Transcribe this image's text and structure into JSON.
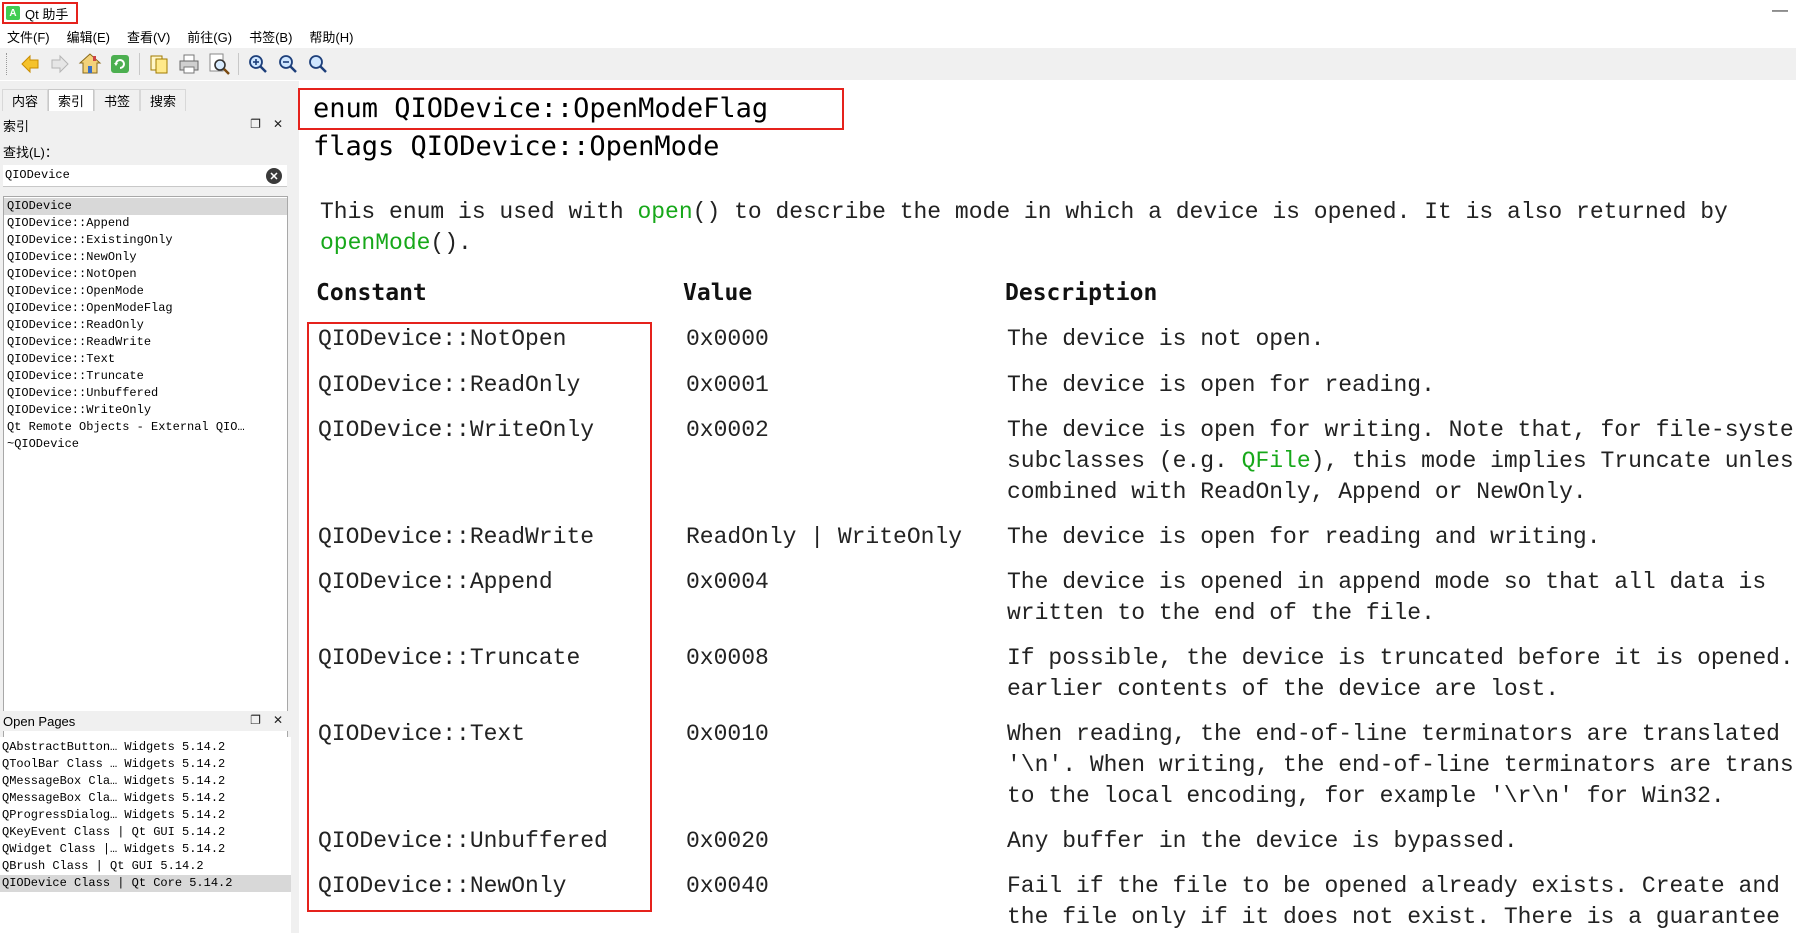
{
  "window": {
    "title": "Qt 助手",
    "minimize_glyph": "—"
  },
  "menu": [
    "文件(F)",
    "编辑(E)",
    "查看(V)",
    "前往(G)",
    "书签(B)",
    "帮助(H)"
  ],
  "toolbar": {
    "buttons": [
      "back-icon",
      "forward-icon",
      "home-icon",
      "sync-icon",
      "copy-icon",
      "print-icon",
      "find-icon",
      "zoom-in-icon",
      "zoom-out-icon",
      "zoom-reset-icon"
    ]
  },
  "sidebar": {
    "tabs": [
      "内容",
      "索引",
      "书签",
      "搜索"
    ],
    "active_tab": "索引",
    "index_panel_title": "索引",
    "find_label": "查找(L)：",
    "search_value": "QIODevice",
    "index_items": [
      "QIODevice",
      "QIODevice::Append",
      "QIODevice::ExistingOnly",
      "QIODevice::NewOnly",
      "QIODevice::NotOpen",
      "QIODevice::OpenMode",
      "QIODevice::OpenModeFlag",
      "QIODevice::ReadOnly",
      "QIODevice::ReadWrite",
      "QIODevice::Text",
      "QIODevice::Truncate",
      "QIODevice::Unbuffered",
      "QIODevice::WriteOnly",
      "Qt Remote Objects - External QIO…",
      "~QIODevice"
    ],
    "open_pages_title": "Open Pages",
    "open_pages": [
      "QAbstractButton… Widgets 5.14.2",
      "QToolBar Class … Widgets 5.14.2",
      "QMessageBox Cla… Widgets 5.14.2",
      "QMessageBox Cla… Widgets 5.14.2",
      "QProgressDialog… Widgets 5.14.2",
      "QKeyEvent Class | Qt GUI 5.14.2",
      "QWidget Class |… Widgets 5.14.2",
      "QBrush Class | Qt GUI 5.14.2",
      "QIODevice Class | Qt Core 5.14.2"
    ]
  },
  "doc": {
    "enum_title": "enum QIODevice::OpenModeFlag",
    "flags_title": "flags QIODevice::OpenMode",
    "intro": {
      "part1": "This enum is used with ",
      "link1": "open",
      "part2": "() to describe the mode in which a device is opened. It is also returned by",
      "link2": "openMode",
      "part3": "()."
    },
    "table_headers": [
      "Constant",
      "Value",
      "Description"
    ],
    "rows": [
      {
        "constant": "QIODevice::NotOpen",
        "value": "0x0000",
        "desc": [
          "The device is not open."
        ]
      },
      {
        "constant": "QIODevice::ReadOnly",
        "value": "0x0001",
        "desc": [
          "The device is open for reading."
        ]
      },
      {
        "constant": "QIODevice::WriteOnly",
        "value": "0x0002",
        "desc": [
          "The device is open for writing. Note that, for file-syste",
          "subclasses (e.g. ",
          "QFile",
          "), this mode implies Truncate unles",
          "combined with ReadOnly, Append or NewOnly."
        ]
      },
      {
        "constant": "QIODevice::ReadWrite",
        "value": "ReadOnly | WriteOnly",
        "desc": [
          "The device is open for reading and writing."
        ]
      },
      {
        "constant": "QIODevice::Append",
        "value": "0x0004",
        "desc": [
          "The device is opened in append mode so that all data is",
          "written to the end of the file."
        ]
      },
      {
        "constant": "QIODevice::Truncate",
        "value": "0x0008",
        "desc": [
          "If possible, the device is truncated before it is opened.",
          "earlier contents of the device are lost."
        ]
      },
      {
        "constant": "QIODevice::Text",
        "value": "0x0010",
        "desc": [
          "When reading, the end-of-line terminators are translated",
          "'\\n'. When writing, the end-of-line terminators are trans",
          "to the local encoding, for example '\\r\\n' for Win32."
        ]
      },
      {
        "constant": "QIODevice::Unbuffered",
        "value": "0x0020",
        "desc": [
          "Any buffer in the device is bypassed."
        ]
      },
      {
        "constant": "QIODevice::NewOnly",
        "value": "0x0040",
        "desc": [
          "Fail if the file to be opened already exists. Create and",
          "the file only if it does not exist. There is a guarantee"
        ]
      }
    ]
  },
  "colors": {
    "highlight_box": "#e5221c",
    "link": "#17a81a",
    "panel_bg": "#f0f0f0"
  }
}
